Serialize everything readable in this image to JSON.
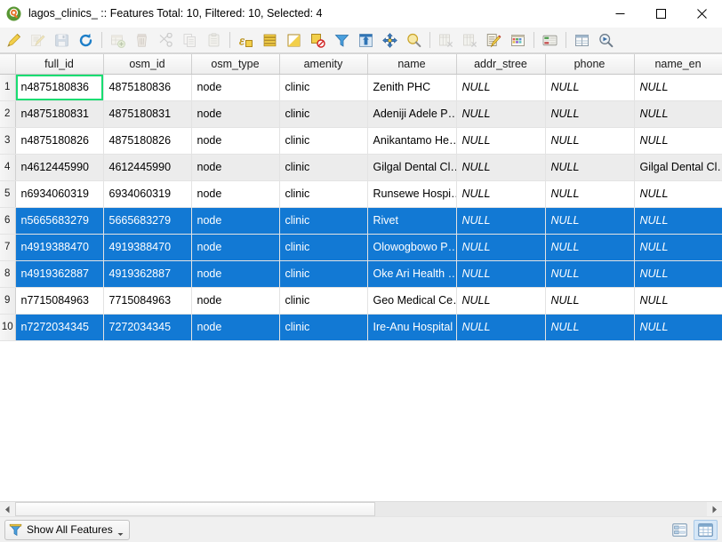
{
  "window": {
    "title": "lagos_clinics_ :: Features Total: 10, Filtered: 10, Selected: 4",
    "app_icon": "qgis-logo-icon",
    "minimize_label": "—",
    "maximize_label": "☐",
    "close_label": "✕"
  },
  "toolbar": {
    "groups": [
      [
        {
          "name": "toggle-editing-icon",
          "tip": "Toggle editing mode",
          "enabled": true
        },
        {
          "name": "save-edits-pencil-icon",
          "tip": "Save edits",
          "enabled": false
        },
        {
          "name": "save-layer-edits-icon",
          "tip": "Save layer edits",
          "enabled": false
        },
        {
          "name": "reload-table-icon",
          "tip": "Reload the table",
          "enabled": true
        }
      ],
      [
        {
          "name": "add-feature-icon",
          "tip": "Add feature",
          "enabled": false
        },
        {
          "name": "delete-selected-icon",
          "tip": "Delete selected features",
          "enabled": false
        },
        {
          "name": "cut-features-icon",
          "tip": "Cut selected features",
          "enabled": false
        },
        {
          "name": "copy-features-icon",
          "tip": "Copy selected features",
          "enabled": false
        },
        {
          "name": "paste-features-icon",
          "tip": "Paste features",
          "enabled": false
        }
      ],
      [
        {
          "name": "select-by-expression-icon",
          "tip": "Select features using an expression",
          "enabled": true
        },
        {
          "name": "select-all-icon",
          "tip": "Select all features",
          "enabled": true
        },
        {
          "name": "invert-selection-icon",
          "tip": "Invert selection",
          "enabled": true
        },
        {
          "name": "deselect-all-icon",
          "tip": "Deselect all features",
          "enabled": true
        },
        {
          "name": "filter-selection-icon",
          "tip": "Filter / Select features using form",
          "enabled": true
        },
        {
          "name": "move-selection-to-top-icon",
          "tip": "Move selection to top",
          "enabled": true
        },
        {
          "name": "pan-map-to-selected-icon",
          "tip": "Pan map to selected rows",
          "enabled": true
        },
        {
          "name": "zoom-map-to-selected-icon",
          "tip": "Zoom map to selected rows",
          "enabled": true
        }
      ],
      [
        {
          "name": "new-field-icon",
          "tip": "New field",
          "enabled": false
        },
        {
          "name": "delete-field-icon",
          "tip": "Delete field",
          "enabled": false
        },
        {
          "name": "open-field-calculator-icon",
          "tip": "Open field calculator",
          "enabled": true
        },
        {
          "name": "conditional-formatting-icon",
          "tip": "Conditional formatting",
          "enabled": true
        }
      ],
      [
        {
          "name": "multi-edit-attributes-icon",
          "tip": "Toggle multi edit mode",
          "enabled": true
        }
      ],
      [
        {
          "name": "organize-columns-icon",
          "tip": "Organize columns",
          "enabled": true
        },
        {
          "name": "actions-icon",
          "tip": "Actions",
          "enabled": true
        }
      ]
    ]
  },
  "table": {
    "columns": [
      "full_id",
      "osm_id",
      "osm_type",
      "amenity",
      "name",
      "addr_stree",
      "phone",
      "name_en"
    ],
    "null_text": "NULL",
    "focused_cell": {
      "row": 0,
      "column": 0
    },
    "rows": [
      {
        "num": "1",
        "selected": false,
        "cells": [
          "n4875180836",
          "4875180836",
          "node",
          "clinic",
          "Zenith PHC",
          "NULL",
          "NULL",
          "NULL"
        ]
      },
      {
        "num": "2",
        "selected": false,
        "cells": [
          "n4875180831",
          "4875180831",
          "node",
          "clinic",
          "Adeniji Adele P…",
          "NULL",
          "NULL",
          "NULL"
        ]
      },
      {
        "num": "3",
        "selected": false,
        "cells": [
          "n4875180826",
          "4875180826",
          "node",
          "clinic",
          "Anikantamo He…",
          "NULL",
          "NULL",
          "NULL"
        ]
      },
      {
        "num": "4",
        "selected": false,
        "cells": [
          "n4612445990",
          "4612445990",
          "node",
          "clinic",
          "Gilgal Dental Cl…",
          "NULL",
          "NULL",
          "Gilgal Dental Cl…"
        ]
      },
      {
        "num": "5",
        "selected": false,
        "cells": [
          "n6934060319",
          "6934060319",
          "node",
          "clinic",
          "Runsewe Hospi…",
          "NULL",
          "NULL",
          "NULL"
        ]
      },
      {
        "num": "6",
        "selected": true,
        "cells": [
          "n5665683279",
          "5665683279",
          "node",
          "clinic",
          "Rivet",
          "NULL",
          "NULL",
          "NULL"
        ]
      },
      {
        "num": "7",
        "selected": true,
        "cells": [
          "n4919388470",
          "4919388470",
          "node",
          "clinic",
          "Olowogbowo P…",
          "NULL",
          "NULL",
          "NULL"
        ]
      },
      {
        "num": "8",
        "selected": true,
        "cells": [
          "n4919362887",
          "4919362887",
          "node",
          "clinic",
          "Oke Ari Health …",
          "NULL",
          "NULL",
          "NULL"
        ]
      },
      {
        "num": "9",
        "selected": false,
        "cells": [
          "n7715084963",
          "7715084963",
          "node",
          "clinic",
          "Geo Medical Ce…",
          "NULL",
          "NULL",
          "NULL"
        ]
      },
      {
        "num": "10",
        "selected": true,
        "cells": [
          "n7272034345",
          "7272034345",
          "node",
          "clinic",
          "Ire-Anu Hospital",
          "NULL",
          "NULL",
          "NULL"
        ]
      }
    ]
  },
  "statusbar": {
    "filter_label": "Show All Features",
    "filter_icon": "funnel-icon",
    "form_view_label": "form-view",
    "table_view_label": "table-view",
    "active_view": "table-view"
  },
  "colors": {
    "selection_blue": "#1279d4",
    "focus_green": "#18dd72",
    "alt_row": "#ececec",
    "null_gray": "#9a9a9a"
  }
}
